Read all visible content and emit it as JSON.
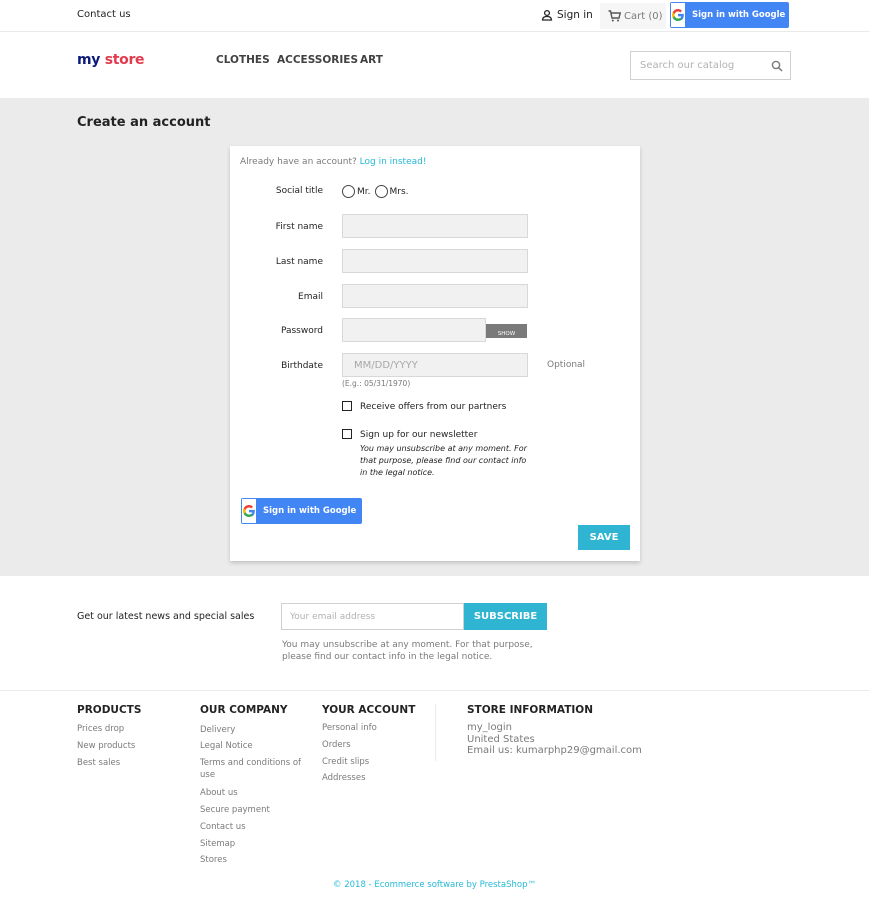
{
  "topbar": {
    "contact": "Contact us",
    "signin": "Sign in",
    "cart": "Cart (0)",
    "google_btn": "Sign in with Google"
  },
  "header": {
    "logo_part1": "my ",
    "logo_part2": "store",
    "nav": [
      "CLOTHES",
      "ACCESSORIES",
      "ART"
    ],
    "search_placeholder": "Search our catalog"
  },
  "page": {
    "title": "Create an account",
    "already_text": "Already have an account? ",
    "login_link": "Log in instead!"
  },
  "form": {
    "social_title_label": "Social title",
    "mr": "Mr.",
    "mrs": "Mrs.",
    "first_name_label": "First name",
    "last_name_label": "Last name",
    "email_label": "Email",
    "password_label": "Password",
    "show_btn": "SHOW",
    "birthdate_label": "Birthdate",
    "birthdate_placeholder": "MM/DD/YYYY",
    "optional": "Optional",
    "date_hint": "(E.g.: 05/31/1970)",
    "offers_label": "Receive offers from our partners",
    "newsletter_label": "Sign up for our newsletter",
    "newsletter_note": "You may unsubscribe at any moment. For that purpose, please find our contact info in the legal notice.",
    "google_btn": "Sign in with Google",
    "save": "SAVE"
  },
  "newsletter": {
    "text": "Get our latest news and special sales",
    "placeholder": "Your email address",
    "subscribe": "SUBSCRIBE",
    "note": "You may unsubscribe at any moment. For that purpose, please find our contact info in the legal notice."
  },
  "footer": {
    "products_head": "PRODUCTS",
    "products": [
      "Prices drop",
      "New products",
      "Best sales"
    ],
    "company_head": "OUR COMPANY",
    "company": [
      "Delivery",
      "Legal Notice",
      "Terms and conditions of use",
      "About us",
      "Secure payment",
      "Contact us",
      "Sitemap",
      "Stores"
    ],
    "account_head": "YOUR ACCOUNT",
    "account": [
      "Personal info",
      "Orders",
      "Credit slips",
      "Addresses"
    ],
    "store_head": "STORE INFORMATION",
    "store_line1": "my_login",
    "store_line2": "United States",
    "store_line3": "Email us: kumarphp29@gmail.com",
    "copyright": "© 2018 - Ecommerce software by PrestaShop™"
  }
}
